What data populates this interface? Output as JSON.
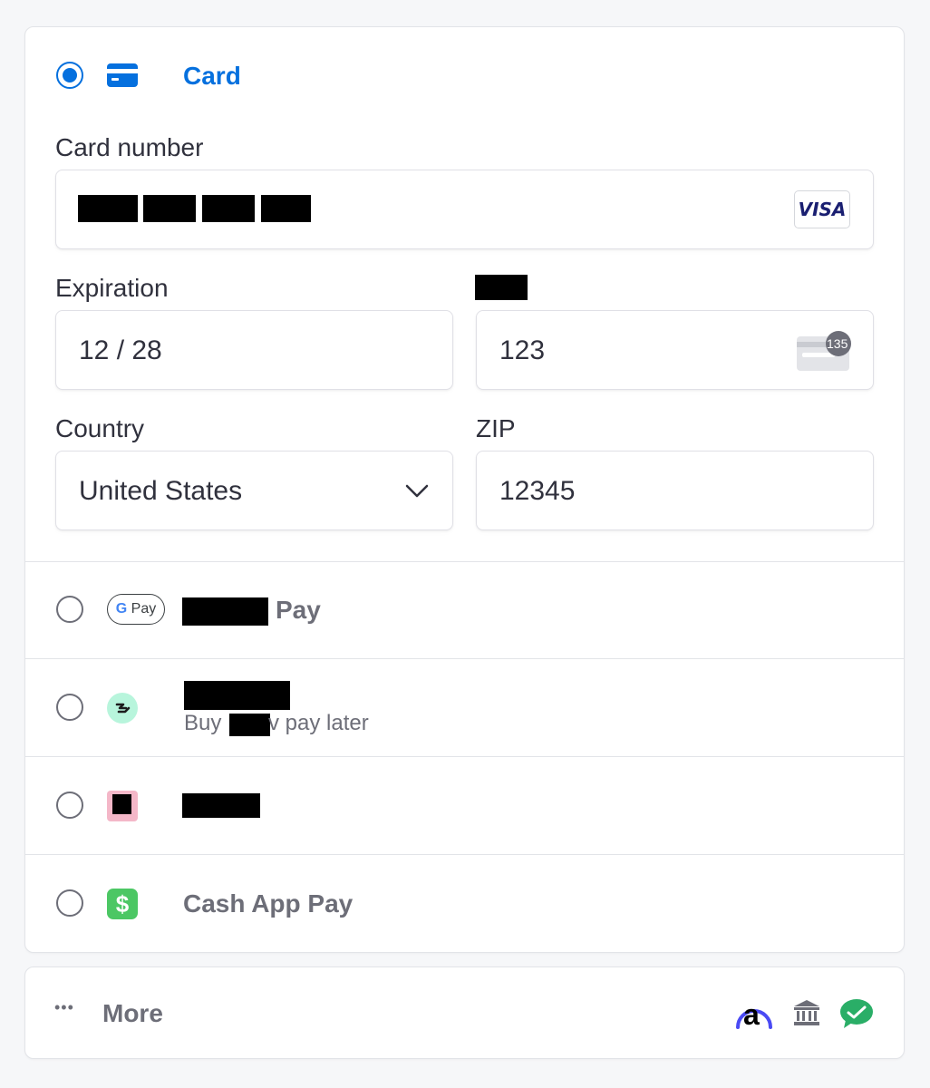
{
  "card_section": {
    "title": "Card",
    "card_number_label": "Card number",
    "card_brand": "VISA",
    "expiration_label": "Expiration",
    "expiration_value": "12 / 28",
    "cvc_value": "123",
    "cvc_icon_text": "135",
    "country_label": "Country",
    "country_value": "United States",
    "zip_label": "ZIP",
    "zip_value": "12345"
  },
  "methods": {
    "google_pay": {
      "badge_g": "G",
      "badge_text": "Pay",
      "label_suffix": "Pay"
    },
    "link": {
      "subtext_start": "Buy",
      "subtext_end": "v pay later"
    },
    "cash_app": {
      "label": "Cash App Pay",
      "icon": "$"
    }
  },
  "more": {
    "dots": "•••",
    "label": "More",
    "icons": [
      "affirm-icon",
      "bank-icon",
      "wechat-pay-icon"
    ],
    "affirm_letter": "a"
  },
  "colors": {
    "accent": "#0570de",
    "cash_app": "#4cc764",
    "link_bg": "#b8f5dc",
    "affirm": "#4a4af4",
    "wechat": "#2aae67"
  }
}
